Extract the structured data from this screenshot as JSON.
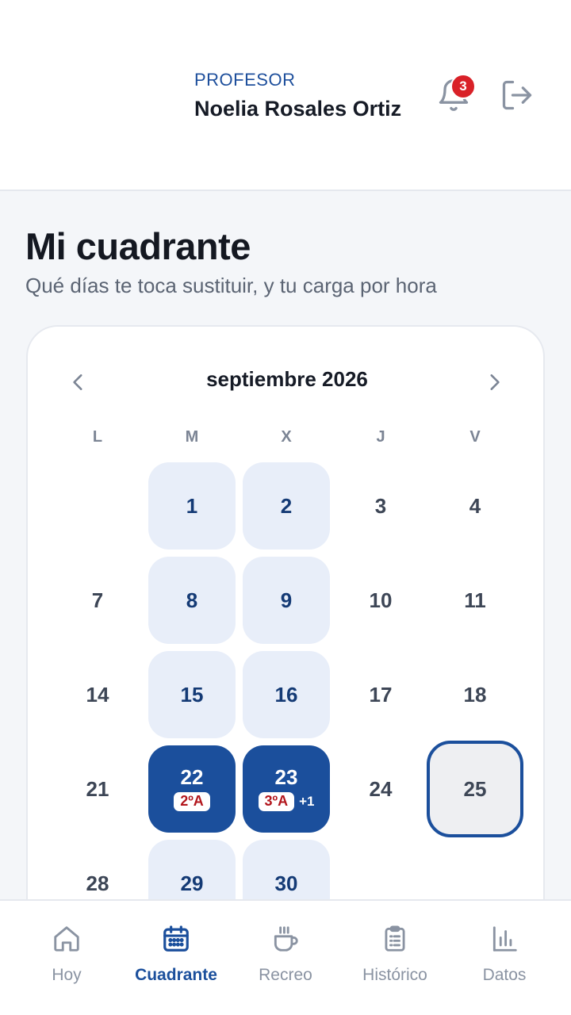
{
  "header": {
    "role": "PROFESOR",
    "user_name": "Noelia Rosales Ortiz",
    "notifications_count": "3"
  },
  "page": {
    "title": "Mi cuadrante",
    "subtitle": "Qué días te toca sustituir, y tu carga por hora"
  },
  "calendar": {
    "month_label": "septiembre 2026",
    "weekdays": [
      "L",
      "M",
      "X",
      "J",
      "V"
    ],
    "days": {
      "d1": "1",
      "d2": "2",
      "d3": "3",
      "d4": "4",
      "d7": "7",
      "d8": "8",
      "d9": "9",
      "d10": "10",
      "d11": "11",
      "d14": "14",
      "d15": "15",
      "d16": "16",
      "d17": "17",
      "d18": "18",
      "d21": "21",
      "d22": "22",
      "d23": "23",
      "d24": "24",
      "d25": "25",
      "d28": "28",
      "d29": "29",
      "d30": "30"
    },
    "assignments": {
      "d22": {
        "group": "2ºA"
      },
      "d23": {
        "group": "3ºA",
        "extra": "+1"
      }
    }
  },
  "bottom_nav": [
    {
      "label": "Hoy",
      "icon": "home-icon"
    },
    {
      "label": "Cuadrante",
      "icon": "calendar-icon",
      "active": true
    },
    {
      "label": "Recreo",
      "icon": "coffee-icon"
    },
    {
      "label": "Histórico",
      "icon": "clipboard-icon"
    },
    {
      "label": "Datos",
      "icon": "bar-chart-icon"
    }
  ],
  "colors": {
    "primary": "#1b4f9c",
    "light_day": "#e8eef9",
    "alert": "#d92128",
    "chip_text": "#b2161d"
  }
}
